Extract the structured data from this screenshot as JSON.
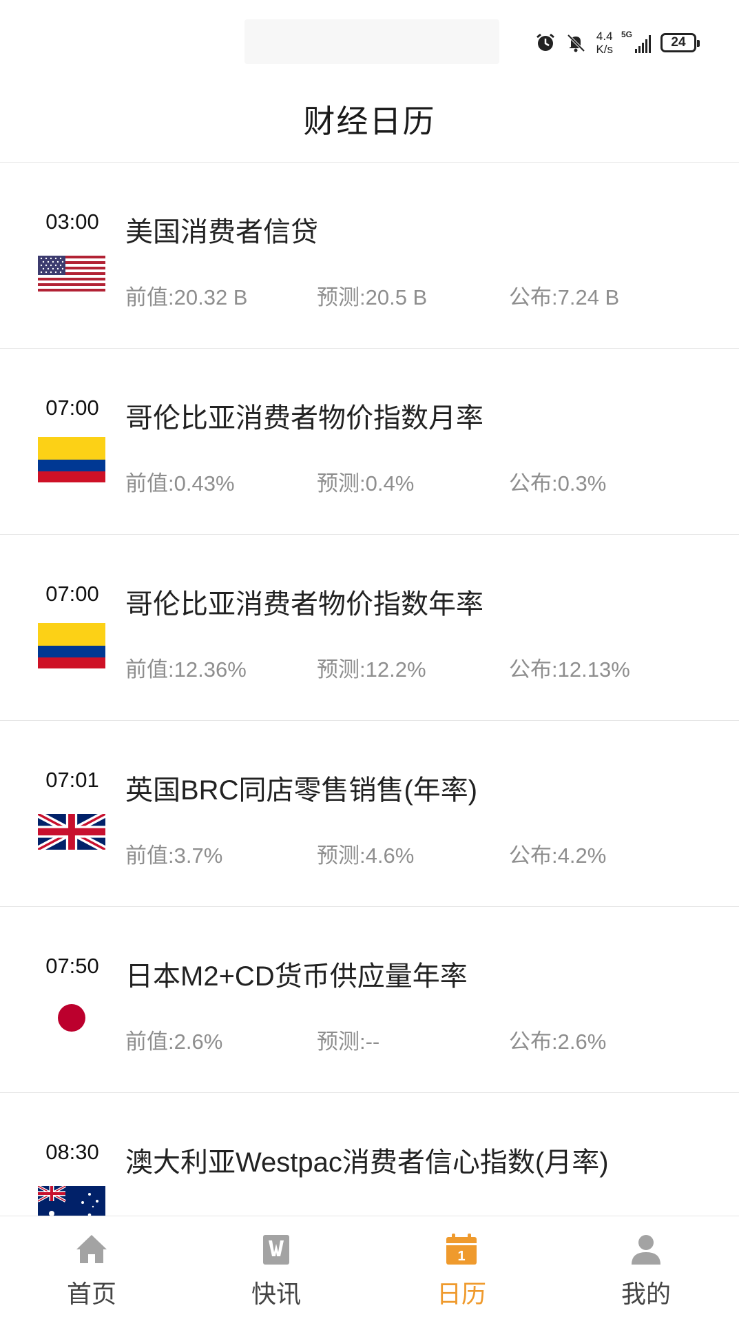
{
  "status_bar": {
    "net_speed_value": "4.4",
    "net_speed_unit": "K/s",
    "network_type": "5G",
    "battery": "24",
    "icons": [
      "alarm-icon",
      "bell-off-icon",
      "signal-icon",
      "battery-icon"
    ]
  },
  "header": {
    "title": "财经日历"
  },
  "events": [
    {
      "time": "03:00",
      "flag": "us-flag",
      "title": "美国消费者信贷",
      "prev": "前值:20.32 B",
      "forecast": "预测:20.5 B",
      "actual": "公布:7.24 B"
    },
    {
      "time": "07:00",
      "flag": "colombia-flag",
      "title": "哥伦比亚消费者物价指数月率",
      "prev": "前值:0.43%",
      "forecast": "预测:0.4%",
      "actual": "公布:0.3%"
    },
    {
      "time": "07:00",
      "flag": "colombia-flag",
      "title": "哥伦比亚消费者物价指数年率",
      "prev": "前值:12.36%",
      "forecast": "预测:12.2%",
      "actual": "公布:12.13%"
    },
    {
      "time": "07:01",
      "flag": "uk-flag",
      "title": "英国BRC同店零售销售(年率)",
      "prev": "前值:3.7%",
      "forecast": "预测:4.6%",
      "actual": "公布:4.2%"
    },
    {
      "time": "07:50",
      "flag": "japan-flag",
      "title": "日本M2+CD货币供应量年率",
      "prev": "前值:2.6%",
      "forecast": "预测:--",
      "actual": "公布:2.6%"
    },
    {
      "time": "08:30",
      "flag": "australia-flag",
      "title": "澳大利亚Westpac消费者信心指数(月率)",
      "prev": "",
      "forecast": "",
      "actual": ""
    }
  ],
  "tabbar": {
    "active_color": "#ef9a2d",
    "inactive_icon_color": "#a3a3a3",
    "tabs": [
      {
        "label": "首页",
        "icon": "home-icon"
      },
      {
        "label": "快讯",
        "icon": "news-icon"
      },
      {
        "label": "日历",
        "icon": "calendar-icon",
        "badge": "1",
        "active": true
      },
      {
        "label": "我的",
        "icon": "user-icon"
      }
    ]
  }
}
